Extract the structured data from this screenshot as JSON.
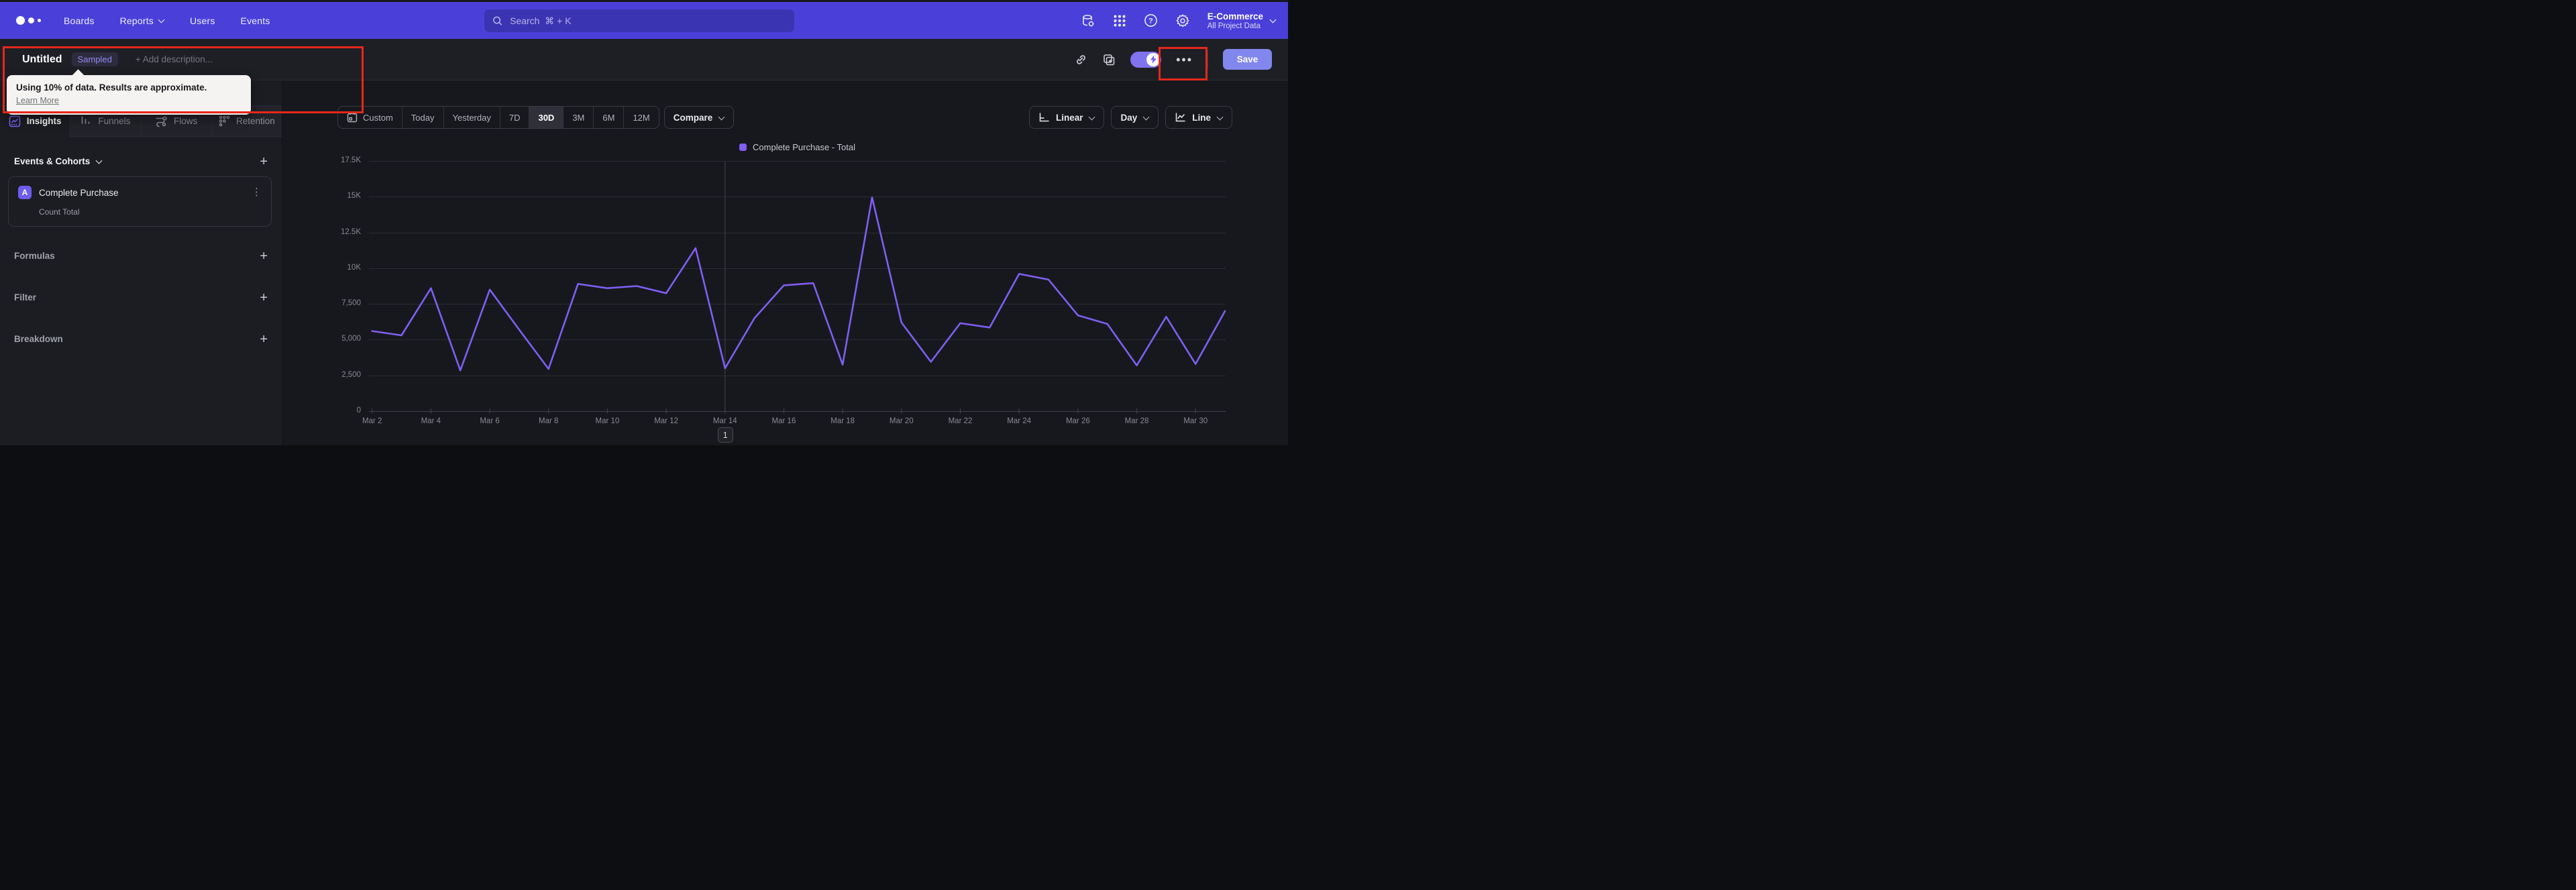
{
  "nav": {
    "items": [
      {
        "label": "Boards",
        "chevron": false
      },
      {
        "label": "Reports",
        "chevron": true
      },
      {
        "label": "Users",
        "chevron": false
      },
      {
        "label": "Events",
        "chevron": false
      }
    ],
    "search_placeholder": "Search  ⌘ + K",
    "project_name": "E-Commerce",
    "project_scope": "All Project Data"
  },
  "titlebar": {
    "title": "Untitled",
    "badge": "Sampled",
    "add_description": "+ Add description...",
    "more_label": "•••",
    "save_label": "Save"
  },
  "tooltip": {
    "line1": "Using 10% of data. Results are approximate.",
    "link": "Learn More"
  },
  "tabs": [
    {
      "label": "Insights",
      "active": true
    },
    {
      "label": "Funnels",
      "active": false
    },
    {
      "label": "Flows",
      "active": false
    },
    {
      "label": "Retention",
      "active": false
    }
  ],
  "builder": {
    "events_header": "Events & Cohorts",
    "event_card": {
      "letter": "A",
      "name": "Complete Purchase",
      "metric": "Count Total"
    },
    "sections": [
      "Formulas",
      "Filter",
      "Breakdown"
    ]
  },
  "controls": {
    "ranges": [
      "Custom",
      "Today",
      "Yesterday",
      "7D",
      "30D",
      "3M",
      "6M",
      "12M"
    ],
    "active_range": "30D",
    "compare_label": "Compare",
    "scale_label": "Linear",
    "interval_label": "Day",
    "chart_type_label": "Line"
  },
  "chart_data": {
    "type": "line",
    "title": "",
    "x": [
      "Mar 2",
      "Mar 3",
      "Mar 4",
      "Mar 5",
      "Mar 6",
      "Mar 7",
      "Mar 8",
      "Mar 9",
      "Mar 10",
      "Mar 11",
      "Mar 12",
      "Mar 13",
      "Mar 14",
      "Mar 15",
      "Mar 16",
      "Mar 17",
      "Mar 18",
      "Mar 19",
      "Mar 20",
      "Mar 21",
      "Mar 22",
      "Mar 23",
      "Mar 24",
      "Mar 25",
      "Mar 26",
      "Mar 27",
      "Mar 28",
      "Mar 29",
      "Mar 30",
      "Mar 31"
    ],
    "x_label_every": 2,
    "series": [
      {
        "name": "Complete Purchase - Total",
        "color": "#7d5ff2",
        "values": [
          5600,
          5300,
          8600,
          2850,
          8500,
          5700,
          2950,
          8900,
          8600,
          8750,
          8250,
          11400,
          3000,
          6500,
          8800,
          8950,
          3250,
          14950,
          6200,
          3450,
          6150,
          5850,
          9600,
          9200,
          6700,
          6100,
          3200,
          6600,
          3300,
          7000
        ]
      }
    ],
    "ylim": [
      0,
      17500
    ],
    "yticks": [
      {
        "v": 0,
        "label": "0"
      },
      {
        "v": 2500,
        "label": "2,500"
      },
      {
        "v": 5000,
        "label": "5,000"
      },
      {
        "v": 7500,
        "label": "7,500"
      },
      {
        "v": 10000,
        "label": "10K"
      },
      {
        "v": 12500,
        "label": "12.5K"
      },
      {
        "v": 15000,
        "label": "15K"
      },
      {
        "v": 17500,
        "label": "17.5K"
      }
    ],
    "grid": true,
    "legend_position": "top-center",
    "annotation": {
      "index": 12,
      "label": "1"
    }
  },
  "colors": {
    "accent": "#7d5ff2",
    "nav_bg": "#4a40d9",
    "save_bg": "#8187ec",
    "annotation_red": "#e5281b"
  }
}
